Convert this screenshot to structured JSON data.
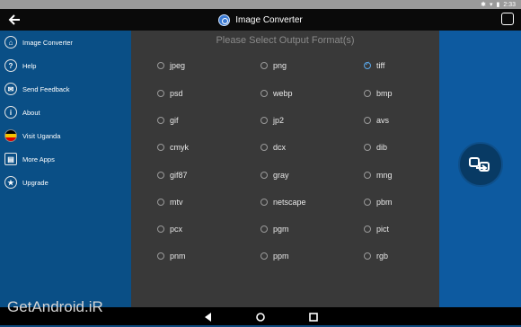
{
  "status_bar": {
    "time": "2:33"
  },
  "app_bar": {
    "back_icon": "back-arrow-icon",
    "title": "Image Converter",
    "menu_icon": "square-menu-icon"
  },
  "sidebar": {
    "items": [
      {
        "label": "Image Converter",
        "icon": "home-icon"
      },
      {
        "label": "Help",
        "icon": "question-icon"
      },
      {
        "label": "Send Feedback",
        "icon": "mail-icon"
      },
      {
        "label": "About",
        "icon": "info-icon"
      },
      {
        "label": "Visit Uganda",
        "icon": "flag-icon"
      },
      {
        "label": "More Apps",
        "icon": "store-icon"
      },
      {
        "label": "Upgrade",
        "icon": "star-icon"
      }
    ]
  },
  "main": {
    "title": "Please Select Output Format(s)",
    "formats": [
      [
        "jpeg",
        "png",
        "tiff"
      ],
      [
        "psd",
        "webp",
        "bmp"
      ],
      [
        "gif",
        "jp2",
        "avs"
      ],
      [
        "cmyk",
        "dcx",
        "dib"
      ],
      [
        "gif87",
        "gray",
        "mng"
      ],
      [
        "mtv",
        "netscape",
        "pbm"
      ],
      [
        "pcx",
        "pgm",
        "pict"
      ],
      [
        "pnm",
        "ppm",
        "rgb"
      ]
    ],
    "selected": "tiff"
  },
  "convert_button": {
    "icon": "convert-arrow-icon"
  },
  "nav_bar": {
    "back_icon": "nav-back-icon",
    "home_icon": "nav-home-icon",
    "recents_icon": "nav-recents-icon"
  },
  "watermark": "GetAndroid.iR",
  "colors": {
    "sidebar": "#0a4f86",
    "content": "#393939",
    "right_panel": "#0d5aa0",
    "accent": "#5aa7e8"
  }
}
